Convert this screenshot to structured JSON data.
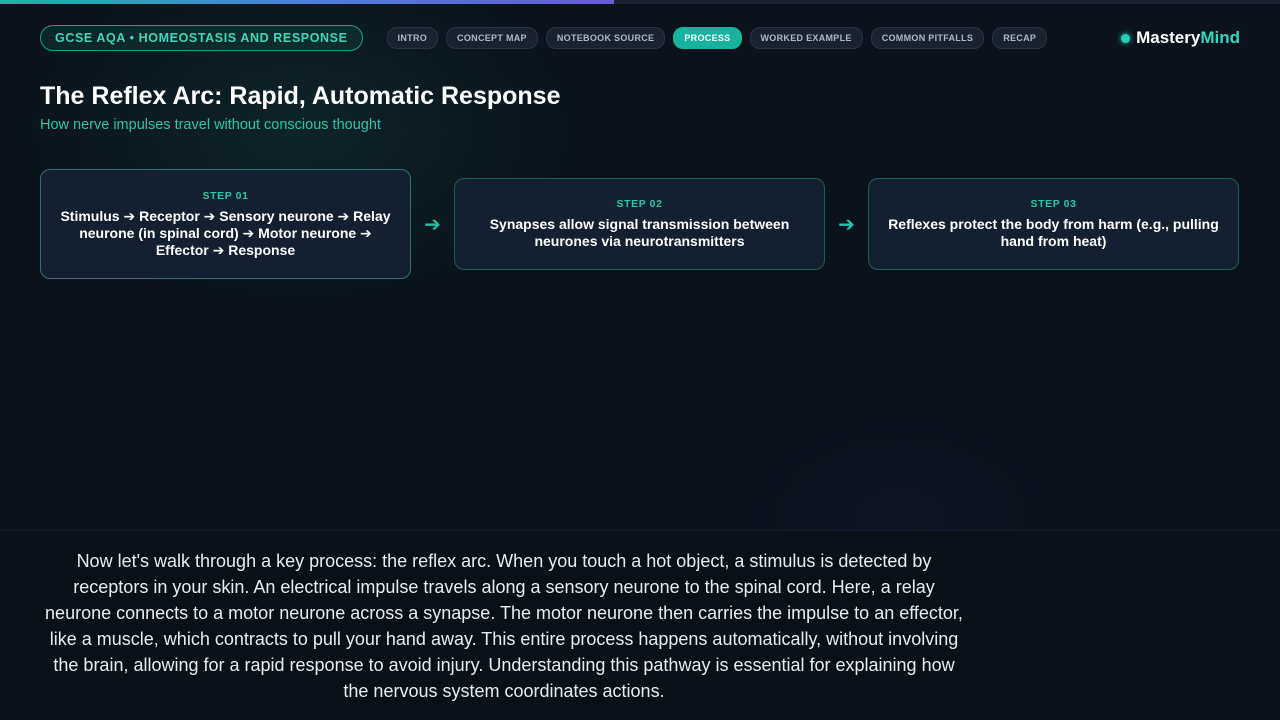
{
  "progress": {
    "percent": 48
  },
  "header": {
    "course_label": "GCSE AQA • HOMEOSTASIS AND RESPONSE",
    "tabs": [
      {
        "label": "INTRO",
        "active": false
      },
      {
        "label": "CONCEPT MAP",
        "active": false
      },
      {
        "label": "NOTEBOOK SOURCE",
        "active": false
      },
      {
        "label": "PROCESS",
        "active": true
      },
      {
        "label": "WORKED EXAMPLE",
        "active": false
      },
      {
        "label": "COMMON PITFALLS",
        "active": false
      },
      {
        "label": "RECAP",
        "active": false
      }
    ],
    "brand": {
      "part1": "Mastery",
      "part2": "Mind"
    }
  },
  "main": {
    "title": "The Reflex Arc: Rapid, Automatic Response",
    "subtitle": "How nerve impulses travel without conscious thought",
    "steps": [
      {
        "label": "STEP 01",
        "text": "Stimulus ➔ Receptor ➔ Sensory neurone ➔ Relay neurone (in spinal cord) ➔ Motor neurone ➔ Effector ➔ Response"
      },
      {
        "label": "STEP 02",
        "text": "Synapses allow signal transmission between neurones via neurotransmitters"
      },
      {
        "label": "STEP 03",
        "text": "Reflexes protect the body from harm (e.g., pulling hand from heat)"
      }
    ],
    "arrow_glyph": "➔"
  },
  "caption": {
    "text": "Now let's walk through a key process: the reflex arc. When you touch a hot object, a stimulus is detected by receptors in your skin. An electrical impulse travels along a sensory neurone to the spinal cord. Here, a relay neurone connects to a motor neurone across a synapse. The motor neurone then carries the impulse to an effector, like a muscle, which contracts to pull your hand away. This entire process happens automatically, without involving the brain, allowing for a rapid response to avoid injury. Understanding this pathway is essential for explaining how the nervous system coordinates actions."
  },
  "colors": {
    "accent": "#17b39d",
    "accent_text": "#27c6ad",
    "background": "#0b121b",
    "card": "#142030"
  },
  "icons": {
    "brand": "status-dot-icon",
    "step_arrow": "arrow-right-icon"
  }
}
